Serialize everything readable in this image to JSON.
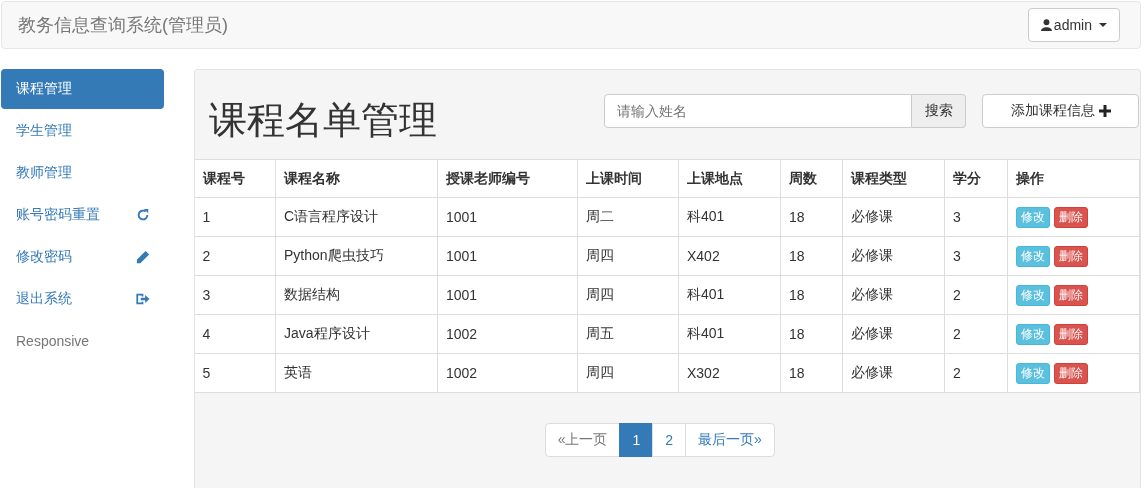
{
  "navbar": {
    "brand": "教务信息查询系统(管理员)",
    "user_menu": "admin"
  },
  "sidebar": {
    "items": [
      {
        "label": "课程管理",
        "kind": "plain",
        "selected": true
      },
      {
        "label": "学生管理",
        "kind": "plain",
        "selected": false
      },
      {
        "label": "教师管理",
        "kind": "plain",
        "selected": false
      },
      {
        "label": "账号密码重置",
        "kind": "reset",
        "selected": false
      },
      {
        "label": "修改密码",
        "kind": "edit",
        "selected": false
      },
      {
        "label": "退出系统",
        "kind": "logout",
        "selected": false
      },
      {
        "label": "Responsive",
        "kind": "muted",
        "selected": false
      }
    ]
  },
  "main": {
    "title": "课程名单管理",
    "search": {
      "placeholder": "请输入姓名",
      "button": "搜索"
    },
    "add_button": "添加课程信息",
    "table": {
      "columns": [
        "课程号",
        "课程名称",
        "授课老师编号",
        "上课时间",
        "上课地点",
        "周数",
        "课程类型",
        "学分",
        "操作"
      ],
      "rows": [
        {
          "cells": [
            "1",
            "C语言程序设计",
            "1001",
            "周二",
            "科401",
            "18",
            "必修课",
            "3"
          ],
          "edit": "修改",
          "delete": "删除"
        },
        {
          "cells": [
            "2",
            "Python爬虫技巧",
            "1001",
            "周四",
            "X402",
            "18",
            "必修课",
            "3"
          ],
          "edit": "修改",
          "delete": "删除"
        },
        {
          "cells": [
            "3",
            "数据结构",
            "1001",
            "周四",
            "科401",
            "18",
            "必修课",
            "2"
          ],
          "edit": "修改",
          "delete": "删除"
        },
        {
          "cells": [
            "4",
            "Java程序设计",
            "1002",
            "周五",
            "科401",
            "18",
            "必修课",
            "2"
          ],
          "edit": "修改",
          "delete": "删除"
        },
        {
          "cells": [
            "5",
            "英语",
            "1002",
            "周四",
            "X302",
            "18",
            "必修课",
            "2"
          ],
          "edit": "修改",
          "delete": "删除"
        }
      ]
    },
    "pagination": [
      {
        "label": "«上一页",
        "selected": false
      },
      {
        "label": "1",
        "selected": true
      },
      {
        "label": "2",
        "selected": false
      },
      {
        "label": "最后一页»",
        "selected": false
      }
    ]
  }
}
